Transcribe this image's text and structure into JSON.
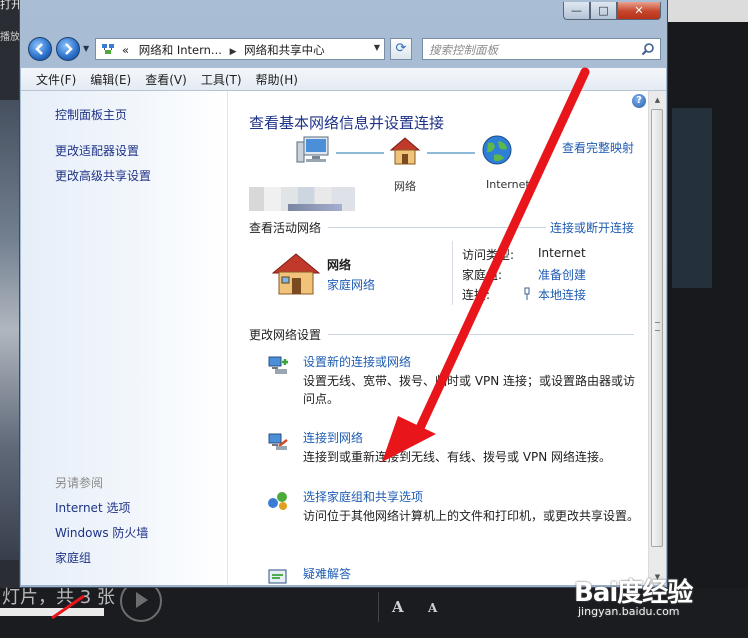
{
  "background": {
    "top_left_text": "打开计",
    "top_left_text2": "播放",
    "bottom_text": "灯片，共 3 张",
    "font_large_label": "A",
    "font_small_label": "A"
  },
  "window": {
    "caption": {
      "minimize": "—",
      "maximize": "□",
      "close": "✕"
    },
    "address": {
      "overflow": "«",
      "crumbs": [
        "网络和 Intern...",
        "网络和共享中心"
      ],
      "search_placeholder": "搜索控制面板"
    },
    "menu": [
      "文件(F)",
      "编辑(E)",
      "查看(V)",
      "工具(T)",
      "帮助(H)"
    ]
  },
  "left_pane": {
    "home": "控制面板主页",
    "links": [
      "更改适配器设置",
      "更改高级共享设置"
    ],
    "see_also_heading": "另请参阅",
    "see_also": [
      "Internet 选项",
      "Windows 防火墙",
      "家庭组"
    ]
  },
  "main": {
    "title": "查看基本网络信息并设置连接",
    "full_map_link": "查看完整映射",
    "map": {
      "network_label": "网络",
      "internet_label": "Internet"
    },
    "active_networks_label": "查看活动网络",
    "connect_disconnect_link": "连接或断开连接",
    "network": {
      "name": "网络",
      "type": "家庭网络"
    },
    "details": [
      {
        "key": "访问类型:",
        "value": "Internet"
      },
      {
        "key": "家庭组:",
        "value": "准备创建"
      },
      {
        "key": "连接:",
        "value": "本地连接"
      }
    ],
    "change_settings_label": "更改网络设置",
    "tasks": [
      {
        "title": "设置新的连接或网络",
        "desc": "设置无线、宽带、拨号、临时或 VPN 连接；或设置路由器或访问点。"
      },
      {
        "title": "连接到网络",
        "desc": "连接到或重新连接到无线、有线、拨号或 VPN 网络连接。"
      },
      {
        "title": "选择家庭组和共享选项",
        "desc": "访问位于其他网络计算机上的文件和打印机，或更改共享设置。"
      },
      {
        "title": "疑难解答",
        "desc": ""
      }
    ]
  },
  "watermark": {
    "logo": "Bai度经验",
    "url": "jingyan.baidu.com"
  },
  "colors": {
    "link": "#1e5cb3",
    "title": "#1e3287",
    "arrow": "#e8151b",
    "frame": "#9cb2cc"
  }
}
